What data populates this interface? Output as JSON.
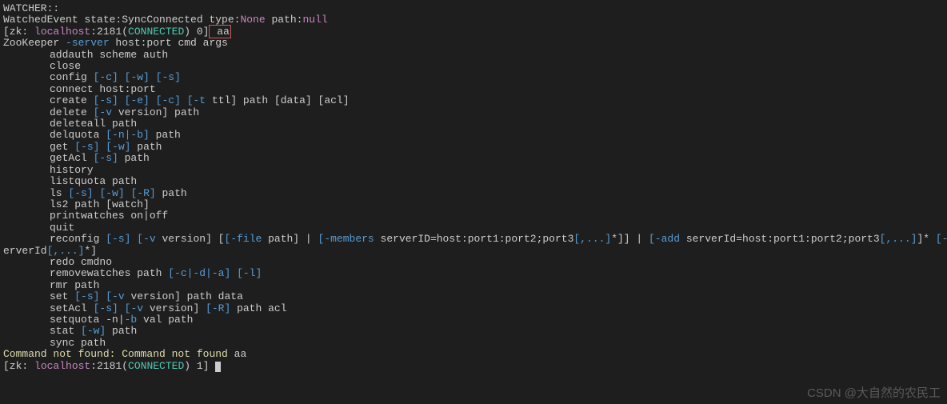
{
  "watcher_header": "WATCHER::",
  "blank": "",
  "watched_event_prefix": "WatchedEvent state:SyncConnected type:",
  "watched_event_none": "None",
  "watched_event_path": " path:",
  "watched_event_null": "null",
  "prompt1": {
    "open": "[zk: ",
    "host": "localhost",
    "colon_port": ":2181(",
    "status": "CONNECTED",
    "close": ") 0]",
    "cmd": " aa"
  },
  "usage_header": "ZooKeeper ",
  "usage_server": "-server",
  "usage_rest": " host:port cmd args",
  "commands": {
    "addauth": "addauth scheme auth",
    "close": "close",
    "config_pre": "config ",
    "config_c": "[-c]",
    "config_sp1": " ",
    "config_w": "[-w]",
    "config_sp2": " ",
    "config_s": "[-s]",
    "connect": "connect host:port",
    "create_pre": "create ",
    "create_s": "[-s]",
    "create_sp1": " ",
    "create_e": "[-e]",
    "create_sp2": " ",
    "create_c": "[-c]",
    "create_sp3": " ",
    "create_t": "[-t",
    "create_rest": " ttl] path [data] [acl]",
    "delete_pre": "delete ",
    "delete_v": "[-v",
    "delete_rest": " version] path",
    "deleteall": "deleteall path",
    "delquota_pre": "delquota ",
    "delquota_nb": "[-n|-b]",
    "delquota_rest": " path",
    "get_pre": "get ",
    "get_s": "[-s]",
    "get_sp": " ",
    "get_w": "[-w]",
    "get_rest": " path",
    "getacl_pre": "getAcl ",
    "getacl_s": "[-s]",
    "getacl_rest": " path",
    "history": "history",
    "listquota": "listquota path",
    "ls_pre": "ls ",
    "ls_s": "[-s]",
    "ls_sp1": " ",
    "ls_w": "[-w]",
    "ls_sp2": " ",
    "ls_r": "[-R]",
    "ls_rest": " path",
    "ls2": "ls2 path [watch]",
    "printwatches": "printwatches on|off",
    "quit": "quit",
    "reconfig_pre": "reconfig ",
    "reconfig_s": "[-s]",
    "reconfig_sp1": " ",
    "reconfig_v": "[-v",
    "reconfig_mid1": " version] [",
    "reconfig_file": "[-file",
    "reconfig_mid2": " path] | ",
    "reconfig_members": "[-members",
    "reconfig_mid3": " serverID=host:port1:port2;port3",
    "reconfig_bracket1": "[,...]",
    "reconfig_mid4": "*]] | ",
    "reconfig_add": "[-add",
    "reconfig_mid5": " serverId=host:port1:port2;port3",
    "reconfig_bracket2": "[,...]",
    "reconfig_mid6": "]* ",
    "reconfig_remove": "[-remove",
    "reconfig_wrap_end": " s",
    "reconfig_line2_pre": "erverId",
    "reconfig_line2_bracket": "[,...]",
    "reconfig_line2_end": "*]",
    "redo": "redo cmdno",
    "removewatches_pre": "removewatches path ",
    "removewatches_cda": "[-c|-d|-a]",
    "removewatches_sp": " ",
    "removewatches_l": "[-l]",
    "rmr": "rmr path",
    "set_pre": "set ",
    "set_s": "[-s]",
    "set_sp": " ",
    "set_v": "[-v",
    "set_rest": " version] path data",
    "setacl_pre": "setAcl ",
    "setacl_s": "[-s]",
    "setacl_sp1": " ",
    "setacl_v": "[-v",
    "setacl_mid": " version] ",
    "setacl_r": "[-R]",
    "setacl_rest": " path acl",
    "setquota_pre": "setquota -n|",
    "setquota_b": "-b",
    "setquota_rest": " val path",
    "stat_pre": "stat ",
    "stat_w": "[-w]",
    "stat_rest": " path",
    "sync": "sync path"
  },
  "error_line": "Command not found: Command not found",
  "error_cmd": " aa",
  "prompt2": {
    "open": "[zk: ",
    "host": "localhost",
    "colon_port": ":2181(",
    "status": "CONNECTED",
    "close": ") 1] "
  },
  "watermark": "CSDN @大自然的农民工"
}
